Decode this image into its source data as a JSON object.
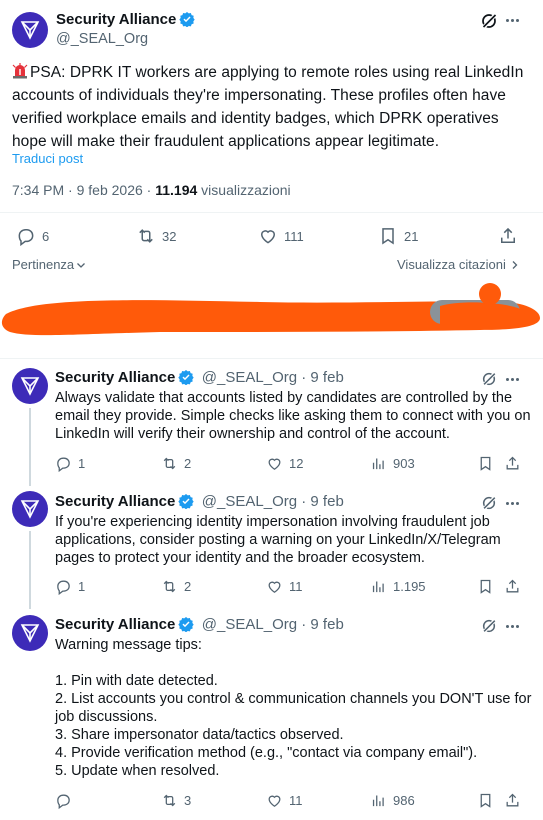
{
  "main_post": {
    "author_name": "Security Alliance",
    "author_handle": "@_SEAL_Org",
    "text": "PSA: DPRK IT workers are applying to remote roles using real LinkedIn accounts of individuals they're impersonating. These profiles often have verified workplace emails and identity badges, which DPRK operatives hope will make their fraudulent applications appear legitimate.",
    "line1": "PSA: DPRK IT workers are applying to remote roles using real LinkedIn",
    "line2": "accounts of individuals they're impersonating. These profiles often have",
    "line3": "verified workplace emails and identity badges, which DPRK operatives",
    "line4": "hope will make their fraudulent applications appear legitimate.",
    "translate": "Traduci post",
    "time": "7:34 PM",
    "sep": " · ",
    "date": "9 feb 2026",
    "views_count": "11.194",
    "views_label": " visualizzazioni",
    "replies": "6",
    "reposts": "32",
    "likes": "111",
    "bookmarks": "21"
  },
  "sort": {
    "label": "Pertinenza",
    "quotes": "Visualizza citazioni"
  },
  "replies": [
    {
      "name": "Security Alliance",
      "handle": "@_SEAL_Org",
      "dot": " · ",
      "date": "9 feb",
      "lines": [
        "Always validate that accounts listed by candidates are controlled by the",
        "email they provide. Simple checks like asking them to connect with you on",
        "LinkedIn will verify their ownership and control of the account."
      ],
      "replies": "1",
      "reposts": "2",
      "likes": "12",
      "views": "903"
    },
    {
      "name": "Security Alliance",
      "handle": "@_SEAL_Org",
      "dot": " · ",
      "date": "9 feb",
      "lines": [
        "If you're experiencing identity impersonation involving fraudulent job",
        "applications, consider posting a warning on your LinkedIn/X/Telegram",
        "pages to protect your identity and the broader ecosystem."
      ],
      "replies": "1",
      "reposts": "2",
      "likes": "11",
      "views": "1.195"
    },
    {
      "name": "Security Alliance",
      "handle": "@_SEAL_Org",
      "dot": " · ",
      "date": "9 feb",
      "lines": [
        "Warning message tips:",
        "",
        "1. Pin with date detected.",
        "2. List accounts you control & communication channels you DON'T use for",
        "job discussions.",
        "3. Share impersonator data/tactics observed.",
        "4. Provide verification method (e.g., \"contact via company email\").",
        "5. Update when resolved."
      ],
      "replies": "",
      "reposts": "3",
      "likes": "11",
      "views": "986"
    }
  ],
  "colors": {
    "brand": "#3d2bb8",
    "verified": "#1d9bf0",
    "redaction": "#ff5a0a",
    "muted": "#536471"
  }
}
